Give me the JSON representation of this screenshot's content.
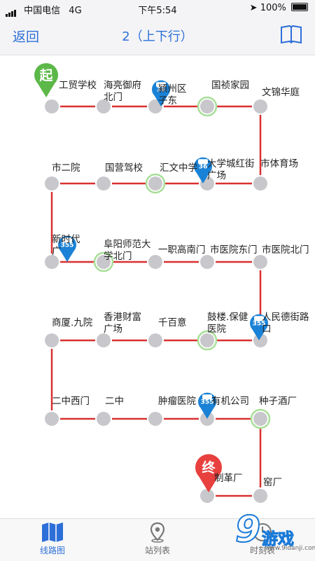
{
  "status_bar": {
    "carrier": "中国电信",
    "network": "4G",
    "time": "下午5:54",
    "battery": "100%"
  },
  "nav": {
    "back_label": "返回",
    "title": "2（上下行）"
  },
  "markers": {
    "start": "起",
    "end": "终",
    "bus_id": "355",
    "bus_id_alt": "36"
  },
  "stations": [
    {
      "name": [
        "工贸学校"
      ]
    },
    {
      "name": [
        "海亮御府",
        "北门"
      ]
    },
    {
      "name": [
        "颍州区",
        "子东"
      ]
    },
    {
      "name": [
        "国祯家园"
      ]
    },
    {
      "name": [
        "文锦华庭"
      ]
    },
    {
      "name": [
        "市体育场"
      ]
    },
    {
      "name": [
        "大学城红街",
        "广场"
      ]
    },
    {
      "name": [
        "汇文中学"
      ]
    },
    {
      "name": [
        "国营驾校"
      ]
    },
    {
      "name": [
        "市二院"
      ]
    },
    {
      "name": [
        "新时代",
        "广"
      ]
    },
    {
      "name": [
        "阜阳师范大",
        "学北门"
      ]
    },
    {
      "name": [
        "一职高南门"
      ]
    },
    {
      "name": [
        "市医院东门"
      ]
    },
    {
      "name": [
        "市医院北门"
      ]
    },
    {
      "name": [
        "人民德街路口"
      ]
    },
    {
      "name": [
        "鼓楼.保健",
        "医院"
      ]
    },
    {
      "name": [
        "千百意"
      ]
    },
    {
      "name": [
        "香港财富",
        "广场"
      ]
    },
    {
      "name": [
        "商厦.九院"
      ]
    },
    {
      "name": [
        "二中西门"
      ]
    },
    {
      "name": [
        "二中"
      ]
    },
    {
      "name": [
        "肿瘤医院"
      ]
    },
    {
      "name": [
        "有机公司"
      ]
    },
    {
      "name": [
        "种子酒厂"
      ]
    },
    {
      "name": [
        "窑厂"
      ]
    },
    {
      "name": [
        "制革厂"
      ]
    }
  ],
  "tabs": [
    {
      "label": "线路图"
    },
    {
      "label": "站列表"
    },
    {
      "label": "时刻表"
    }
  ],
  "watermark": {
    "brand": "游戏",
    "number": "9",
    "url": "www.9idanji.com"
  },
  "colors": {
    "accent": "#2d6fd8",
    "route": "#d93030",
    "station": "#c8c8cc",
    "bus_pin": "#1a82d6",
    "start_pin": "#5cb848",
    "end_pin": "#e8403e",
    "highlight": "#a8df98"
  }
}
